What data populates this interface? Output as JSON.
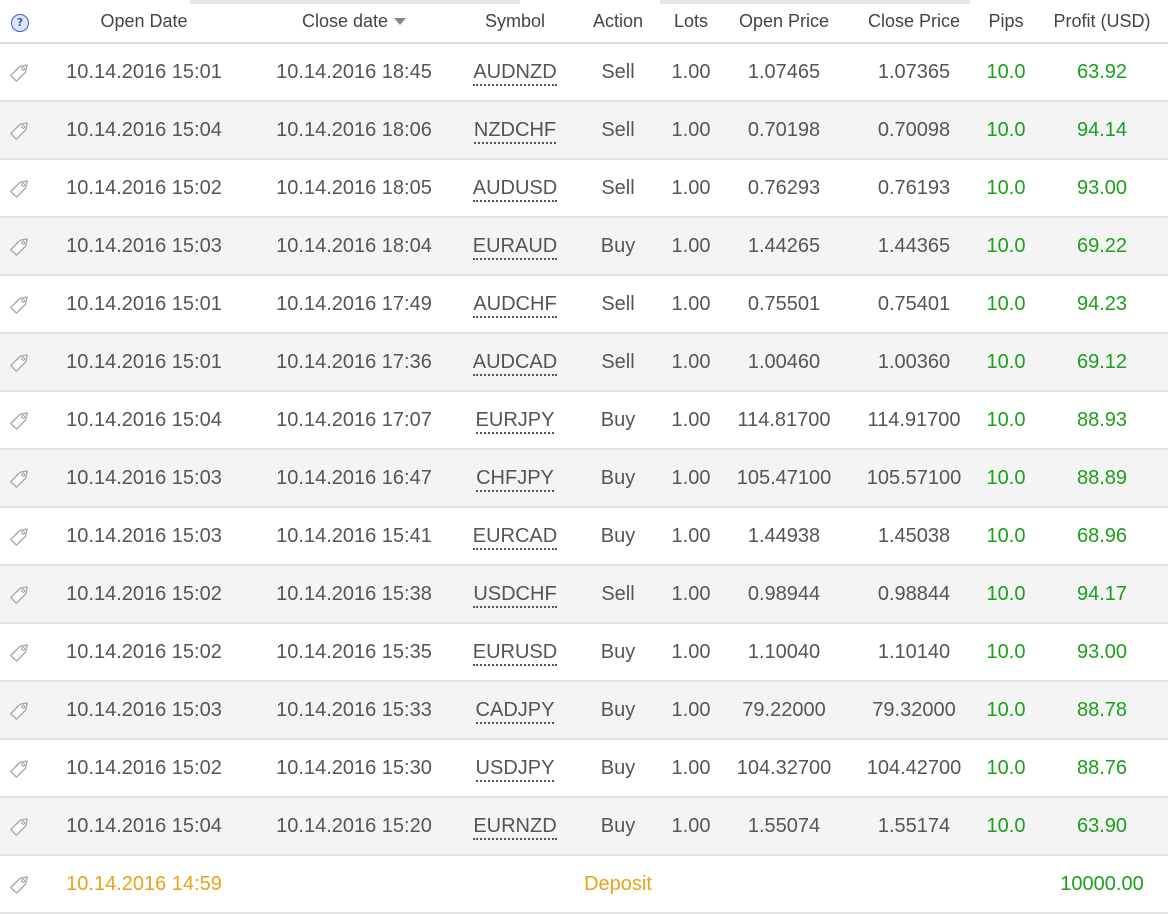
{
  "header": {
    "help_icon": "?",
    "open_date": "Open Date",
    "close_date": "Close date",
    "symbol": "Symbol",
    "action": "Action",
    "lots": "Lots",
    "open_price": "Open Price",
    "close_price": "Close Price",
    "pips": "Pips",
    "profit": "Profit (USD)"
  },
  "colors": {
    "profit": "#1aa01a",
    "deposit": "#e8a317",
    "text": "#555555"
  },
  "icons": {
    "row_icon": "tag-icon",
    "help": "help-icon",
    "sort": "sort-desc-icon"
  },
  "rows": [
    {
      "open_date": "10.14.2016 15:01",
      "close_date": "10.14.2016 18:45",
      "symbol": "AUDNZD",
      "action": "Sell",
      "lots": "1.00",
      "open_price": "1.07465",
      "close_price": "1.07365",
      "pips": "10.0",
      "profit": "63.92"
    },
    {
      "open_date": "10.14.2016 15:04",
      "close_date": "10.14.2016 18:06",
      "symbol": "NZDCHF",
      "action": "Sell",
      "lots": "1.00",
      "open_price": "0.70198",
      "close_price": "0.70098",
      "pips": "10.0",
      "profit": "94.14"
    },
    {
      "open_date": "10.14.2016 15:02",
      "close_date": "10.14.2016 18:05",
      "symbol": "AUDUSD",
      "action": "Sell",
      "lots": "1.00",
      "open_price": "0.76293",
      "close_price": "0.76193",
      "pips": "10.0",
      "profit": "93.00"
    },
    {
      "open_date": "10.14.2016 15:03",
      "close_date": "10.14.2016 18:04",
      "symbol": "EURAUD",
      "action": "Buy",
      "lots": "1.00",
      "open_price": "1.44265",
      "close_price": "1.44365",
      "pips": "10.0",
      "profit": "69.22"
    },
    {
      "open_date": "10.14.2016 15:01",
      "close_date": "10.14.2016 17:49",
      "symbol": "AUDCHF",
      "action": "Sell",
      "lots": "1.00",
      "open_price": "0.75501",
      "close_price": "0.75401",
      "pips": "10.0",
      "profit": "94.23"
    },
    {
      "open_date": "10.14.2016 15:01",
      "close_date": "10.14.2016 17:36",
      "symbol": "AUDCAD",
      "action": "Sell",
      "lots": "1.00",
      "open_price": "1.00460",
      "close_price": "1.00360",
      "pips": "10.0",
      "profit": "69.12"
    },
    {
      "open_date": "10.14.2016 15:04",
      "close_date": "10.14.2016 17:07",
      "symbol": "EURJPY",
      "action": "Buy",
      "lots": "1.00",
      "open_price": "114.81700",
      "close_price": "114.91700",
      "pips": "10.0",
      "profit": "88.93"
    },
    {
      "open_date": "10.14.2016 15:03",
      "close_date": "10.14.2016 16:47",
      "symbol": "CHFJPY",
      "action": "Buy",
      "lots": "1.00",
      "open_price": "105.47100",
      "close_price": "105.57100",
      "pips": "10.0",
      "profit": "88.89"
    },
    {
      "open_date": "10.14.2016 15:03",
      "close_date": "10.14.2016 15:41",
      "symbol": "EURCAD",
      "action": "Buy",
      "lots": "1.00",
      "open_price": "1.44938",
      "close_price": "1.45038",
      "pips": "10.0",
      "profit": "68.96"
    },
    {
      "open_date": "10.14.2016 15:02",
      "close_date": "10.14.2016 15:38",
      "symbol": "USDCHF",
      "action": "Sell",
      "lots": "1.00",
      "open_price": "0.98944",
      "close_price": "0.98844",
      "pips": "10.0",
      "profit": "94.17"
    },
    {
      "open_date": "10.14.2016 15:02",
      "close_date": "10.14.2016 15:35",
      "symbol": "EURUSD",
      "action": "Buy",
      "lots": "1.00",
      "open_price": "1.10040",
      "close_price": "1.10140",
      "pips": "10.0",
      "profit": "93.00"
    },
    {
      "open_date": "10.14.2016 15:03",
      "close_date": "10.14.2016 15:33",
      "symbol": "CADJPY",
      "action": "Buy",
      "lots": "1.00",
      "open_price": "79.22000",
      "close_price": "79.32000",
      "pips": "10.0",
      "profit": "88.78"
    },
    {
      "open_date": "10.14.2016 15:02",
      "close_date": "10.14.2016 15:30",
      "symbol": "USDJPY",
      "action": "Buy",
      "lots": "1.00",
      "open_price": "104.32700",
      "close_price": "104.42700",
      "pips": "10.0",
      "profit": "88.76"
    },
    {
      "open_date": "10.14.2016 15:04",
      "close_date": "10.14.2016 15:20",
      "symbol": "EURNZD",
      "action": "Buy",
      "lots": "1.00",
      "open_price": "1.55074",
      "close_price": "1.55174",
      "pips": "10.0",
      "profit": "63.90"
    }
  ],
  "deposit": {
    "open_date": "10.14.2016 14:59",
    "action": "Deposit",
    "profit": "10000.00"
  }
}
